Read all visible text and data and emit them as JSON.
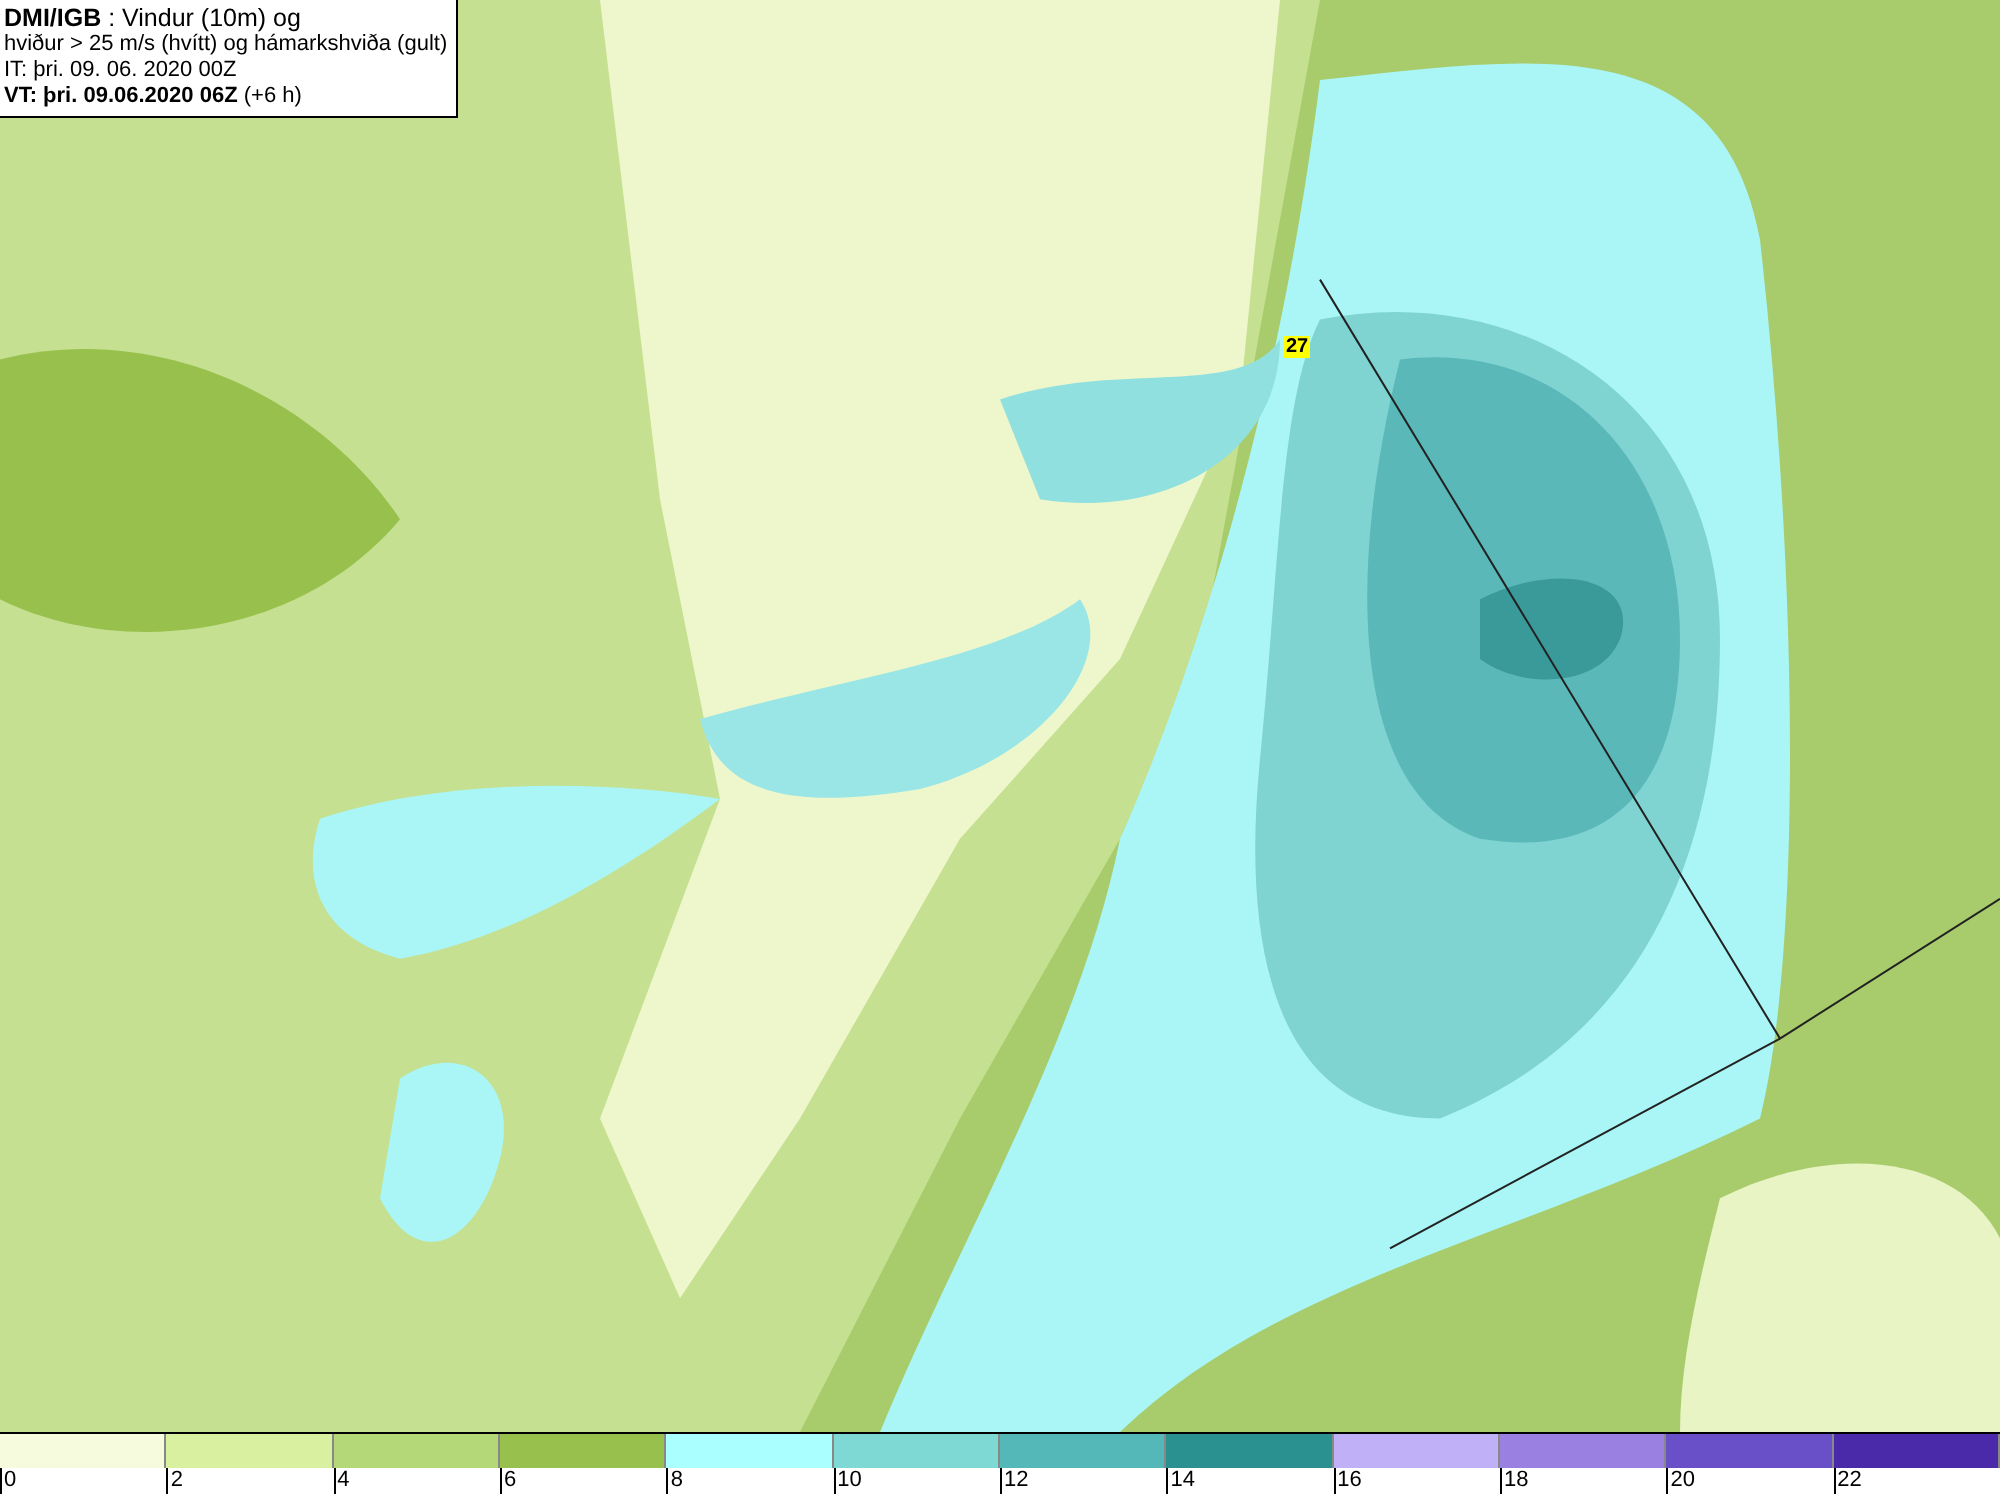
{
  "info_box": {
    "lines": [
      "**DMI/IGB** : Vindur (10m) og",
      "hviður > 25 m/s (hvítt) og hámarkshviða (gult)",
      "IT: þri. 09. 06. 2020 00Z",
      "**VT: þri. 09.06.2020 06Z** (+6 h)"
    ]
  },
  "map": {
    "gust_label": "27"
  },
  "legend": {
    "bins": [
      {
        "color": "#f5fbdc"
      },
      {
        "color": "#d8f0a0"
      },
      {
        "color": "#b4d878"
      },
      {
        "color": "#98c04c"
      },
      {
        "color": "#aaffff"
      },
      {
        "color": "#7ed8d4"
      },
      {
        "color": "#55b8b8"
      },
      {
        "color": "#2a9090"
      },
      {
        "color": "#c0b0f8"
      },
      {
        "color": "#9a80e0"
      },
      {
        "color": "#6a50c8"
      },
      {
        "color": "#4a2aa8"
      }
    ],
    "ticks": [
      "0",
      "2",
      "4",
      "6",
      "8",
      "10",
      "12",
      "14",
      "16",
      "18",
      "20",
      "22"
    ]
  }
}
